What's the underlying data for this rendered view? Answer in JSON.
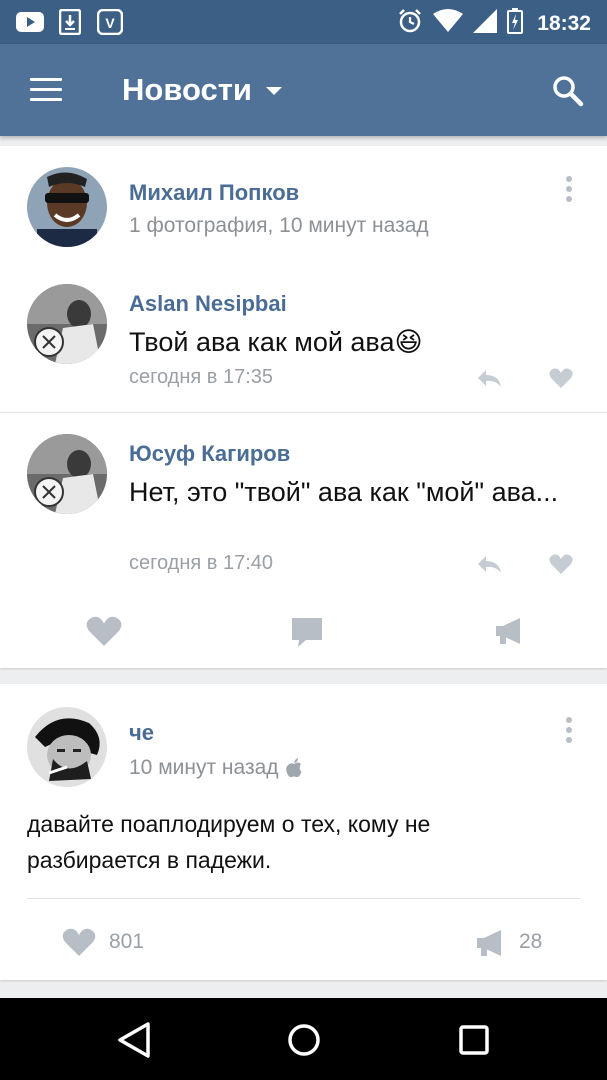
{
  "status_bar": {
    "time": "18:32"
  },
  "app_bar": {
    "title": "Новости"
  },
  "post1": {
    "author": "Михаил Попков",
    "meta": "1 фотография, 10 минут назад",
    "comments": [
      {
        "author": "Aslan Nesipbai",
        "text": "Твой ава как мой ава😆",
        "time": "сегодня в 17:35"
      },
      {
        "author": "Юсуф Кагиров",
        "text": "Нет, это \"твой\" ава как \"мой\" ава...",
        "time": "сегодня в 17:40"
      }
    ]
  },
  "post2": {
    "author": "че",
    "meta": "10 минут назад",
    "text": "давайте поаплодируем о тех, кому не разбирается в падежи.",
    "likes": "801",
    "reposts": "28"
  },
  "colors": {
    "status": "#3c5f85",
    "appbar": "#507299",
    "name": "#4b6d95",
    "icon": "#b8bec5"
  },
  "icons": [
    "youtube-icon",
    "download-icon",
    "vk-icon",
    "alarm-icon",
    "wifi-icon",
    "signal-icon",
    "battery-icon",
    "menu-icon",
    "caret-down-icon",
    "search-icon",
    "more-icon",
    "reply-icon",
    "heart-icon",
    "comment-icon",
    "megaphone-icon",
    "apple-icon",
    "back-icon",
    "home-icon",
    "recents-icon"
  ]
}
